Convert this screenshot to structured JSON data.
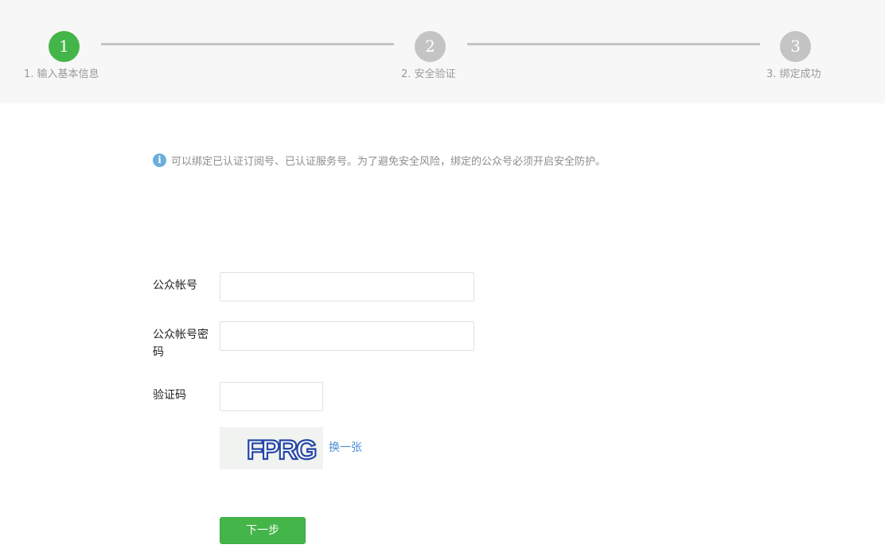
{
  "stepper": {
    "steps": [
      {
        "number": "1",
        "label": "1. 输入基本信息",
        "state": "active"
      },
      {
        "number": "2",
        "label": "2. 安全验证",
        "state": "pending"
      },
      {
        "number": "3",
        "label": "3. 绑定成功",
        "state": "pending"
      }
    ],
    "active_color": "#44b549",
    "pending_color": "#c4c4c4"
  },
  "notice": {
    "icon": "info-icon",
    "text": "可以绑定已认证订阅号、已认证服务号。为了避免安全风险，绑定的公众号必须开启安全防护。"
  },
  "form": {
    "account": {
      "label": "公众帐号",
      "value": "",
      "placeholder": ""
    },
    "password": {
      "label": "公众帐号密码",
      "value": "",
      "placeholder": ""
    },
    "captcha": {
      "label": "验证码",
      "value": "",
      "placeholder": "",
      "image_text": "FPRG",
      "refresh_label": "换一张"
    }
  },
  "actions": {
    "next_label": "下一步"
  },
  "colors": {
    "accent": "#44b549",
    "link": "#4a8fd4",
    "info": "#6aaedb"
  }
}
